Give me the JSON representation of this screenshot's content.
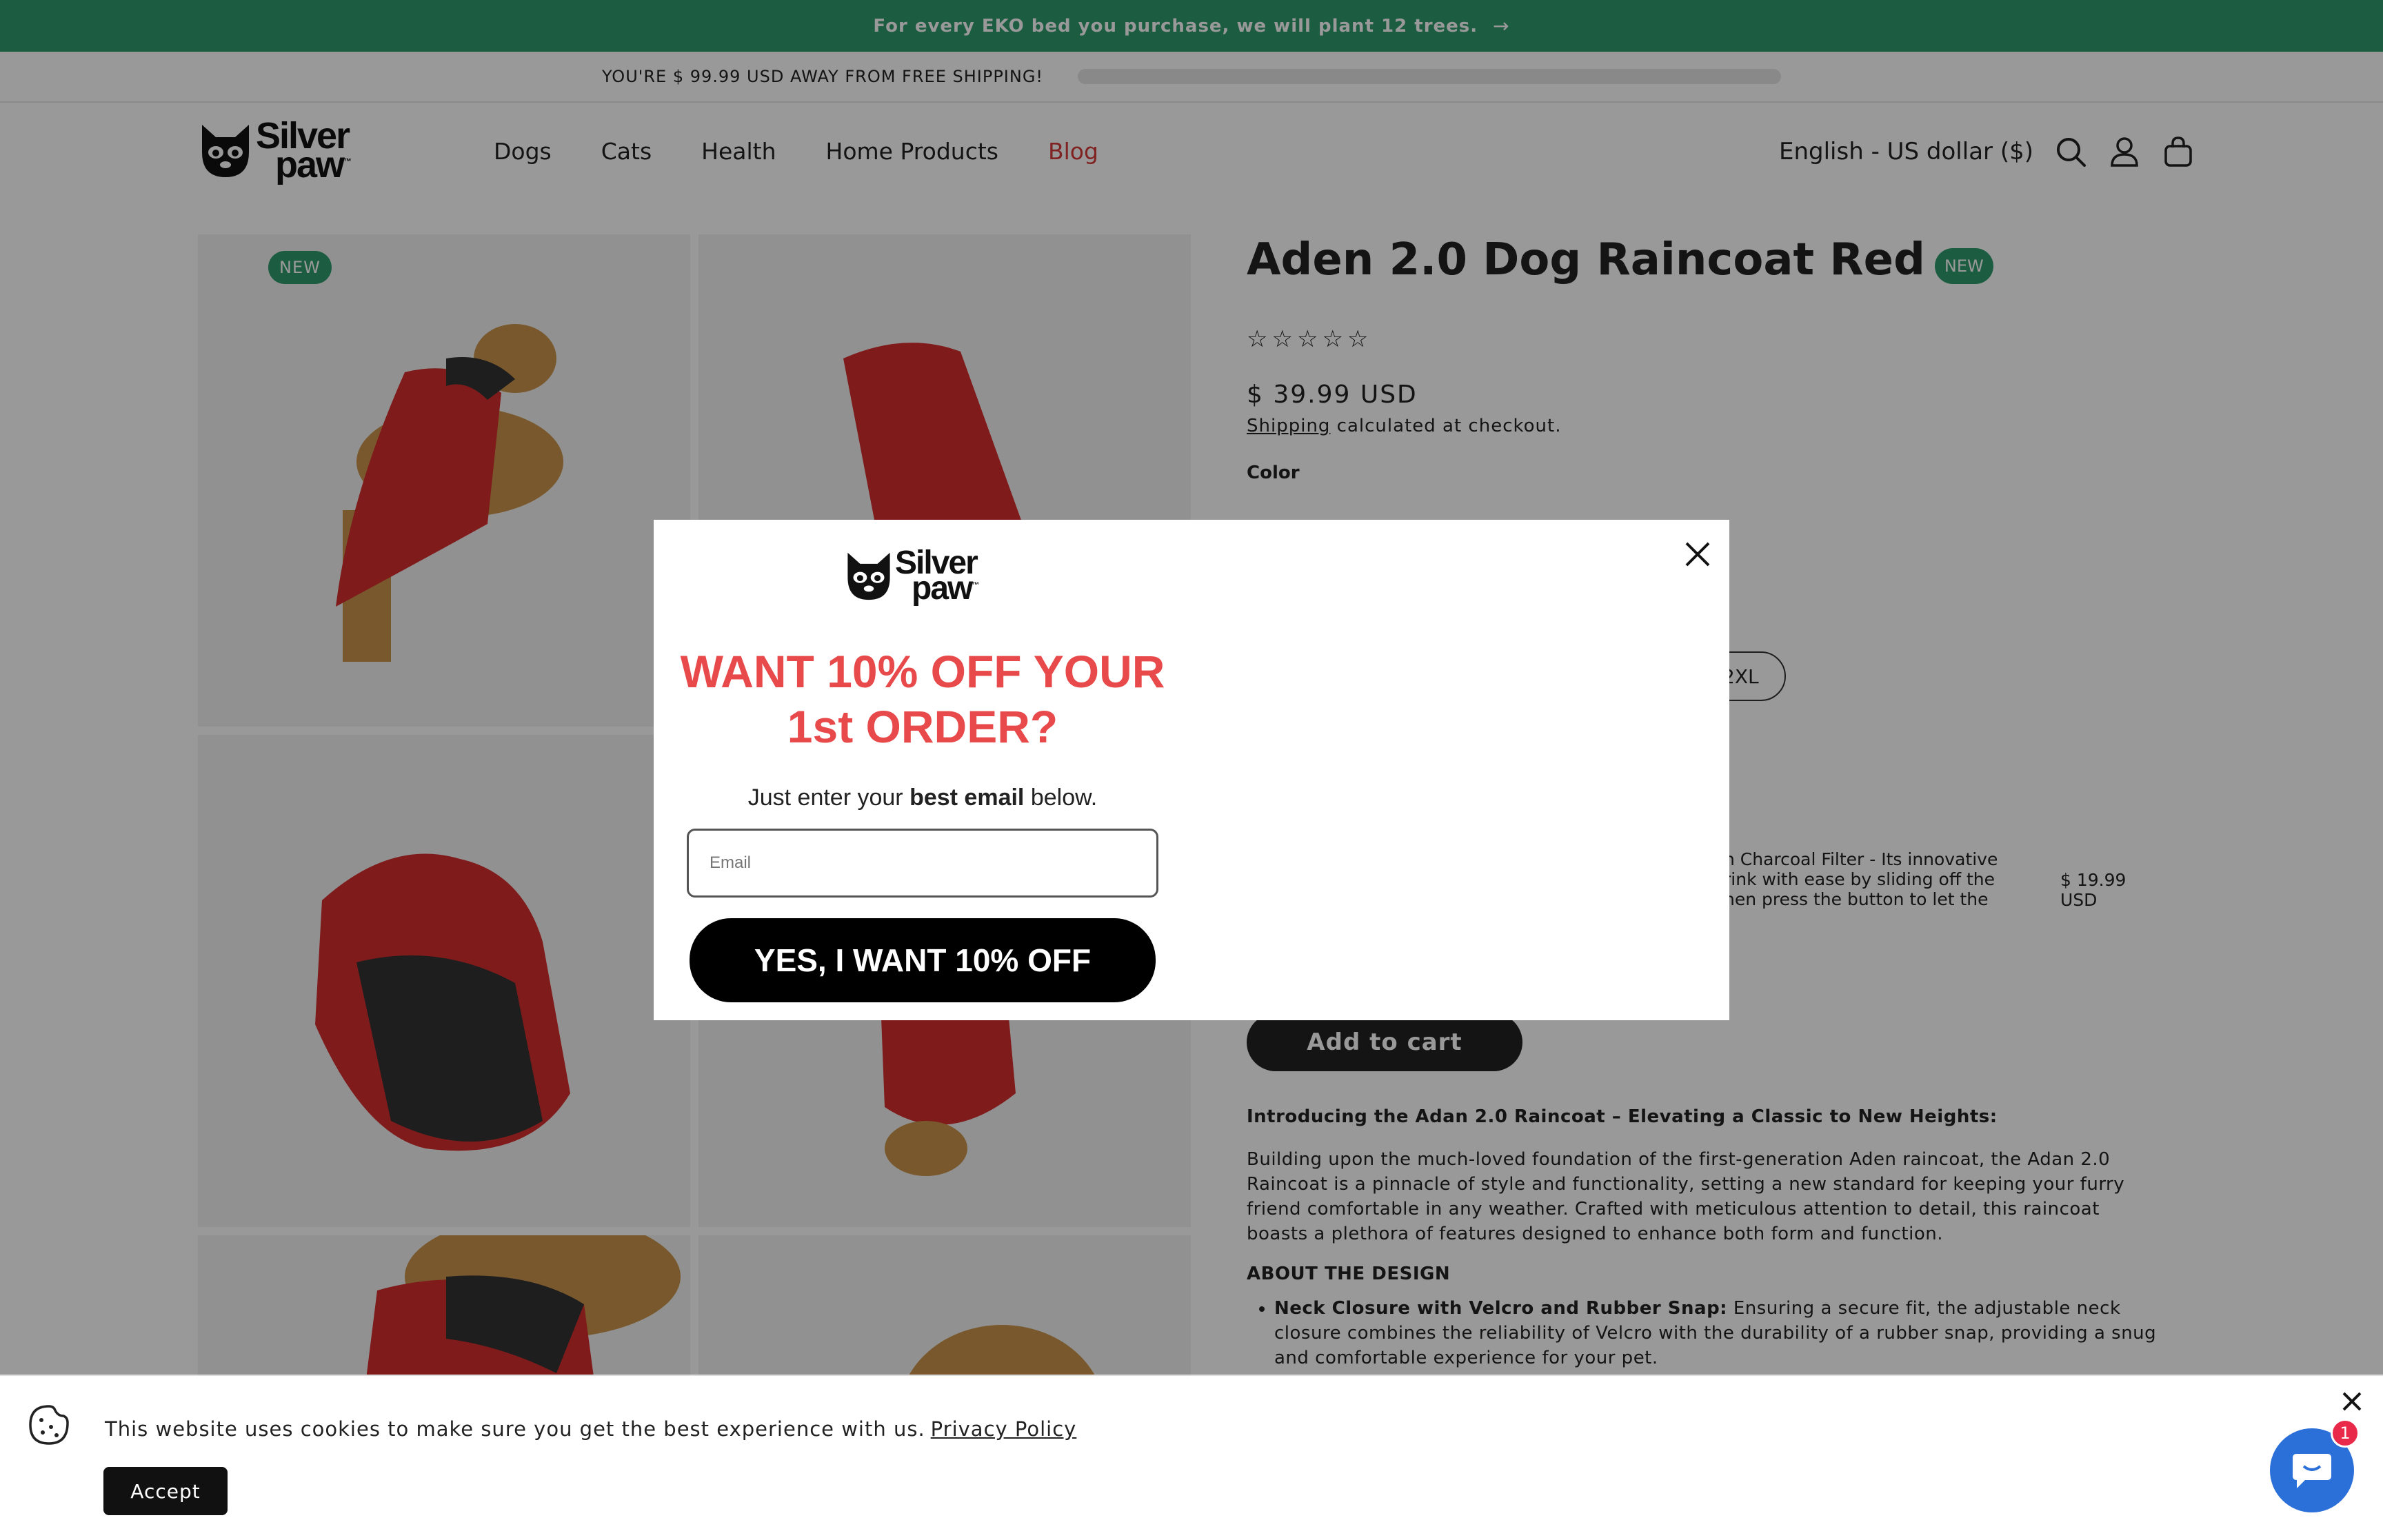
{
  "announcement": {
    "text": "For every EKO bed you purchase, we will plant 12 trees.",
    "arrow": "→"
  },
  "shipping_bar": {
    "text": "YOU'RE $ 99.99 USD AWAY FROM FREE SHIPPING!",
    "progress": 0
  },
  "brand": {
    "line1": "Silver",
    "line2": "paw",
    "tm": "™"
  },
  "nav": {
    "items": [
      "Dogs",
      "Cats",
      "Health",
      "Home Products",
      "Blog"
    ]
  },
  "header": {
    "locale": "English - US dollar ($)",
    "icons": [
      "search-icon",
      "account-icon",
      "cart-icon"
    ]
  },
  "gallery": {
    "badge": "NEW"
  },
  "product": {
    "title": "Aden 2.0 Dog Raincoat Red",
    "badge": "NEW",
    "stars": "☆☆☆☆☆",
    "price": "$ 39.99 USD",
    "shipping_link": "Shipping",
    "shipping_rest": " calculated at checkout.",
    "color_label": "Color",
    "size_visible": "2XL",
    "addon_lines": [
      "h Charcoal Filter - Its innovative",
      "rink with ease by sliding off the",
      "hen press the button to let the"
    ],
    "addon_price_line1": "$ 19.99",
    "addon_price_line2": "USD",
    "add_to_cart": "Add to cart"
  },
  "description": {
    "heading": "Introducing the Adan 2.0 Raincoat – Elevating a Classic to New Heights:",
    "intro": "Building upon the much-loved foundation of the first-generation Aden raincoat, the Adan 2.0 Raincoat is a pinnacle of style and functionality, setting a new standard for keeping your furry friend comfortable in any weather. Crafted with meticulous attention to detail, this raincoat boasts a plethora of features designed to enhance both form and function.",
    "design_heading": "ABOUT THE DESIGN",
    "bullet_bold": "Neck Closure with Velcro and Rubber Snap:",
    "bullet_text": " Ensuring a secure fit, the adjustable neck closure combines the reliability of Velcro with the durability of a rubber snap, providing a snug and comfortable experience for your pet."
  },
  "popup": {
    "headline_line1": "WANT 10% OFF YOUR",
    "headline_line2": "1st ORDER?",
    "sub_pre": "Just enter your ",
    "sub_bold": "best email",
    "sub_post": " below.",
    "email_placeholder": "Email",
    "cta": "YES, I WANT 10% OFF"
  },
  "cookie": {
    "text": "This website uses cookies to make sure you get the best experience with us.",
    "link": "Privacy Policy",
    "accept": "Accept"
  },
  "chat": {
    "badge": "1"
  },
  "colors": {
    "brand_green": "#2f9b6e",
    "accent_red": "#e8494a",
    "chat_blue": "#2b6fd8"
  }
}
